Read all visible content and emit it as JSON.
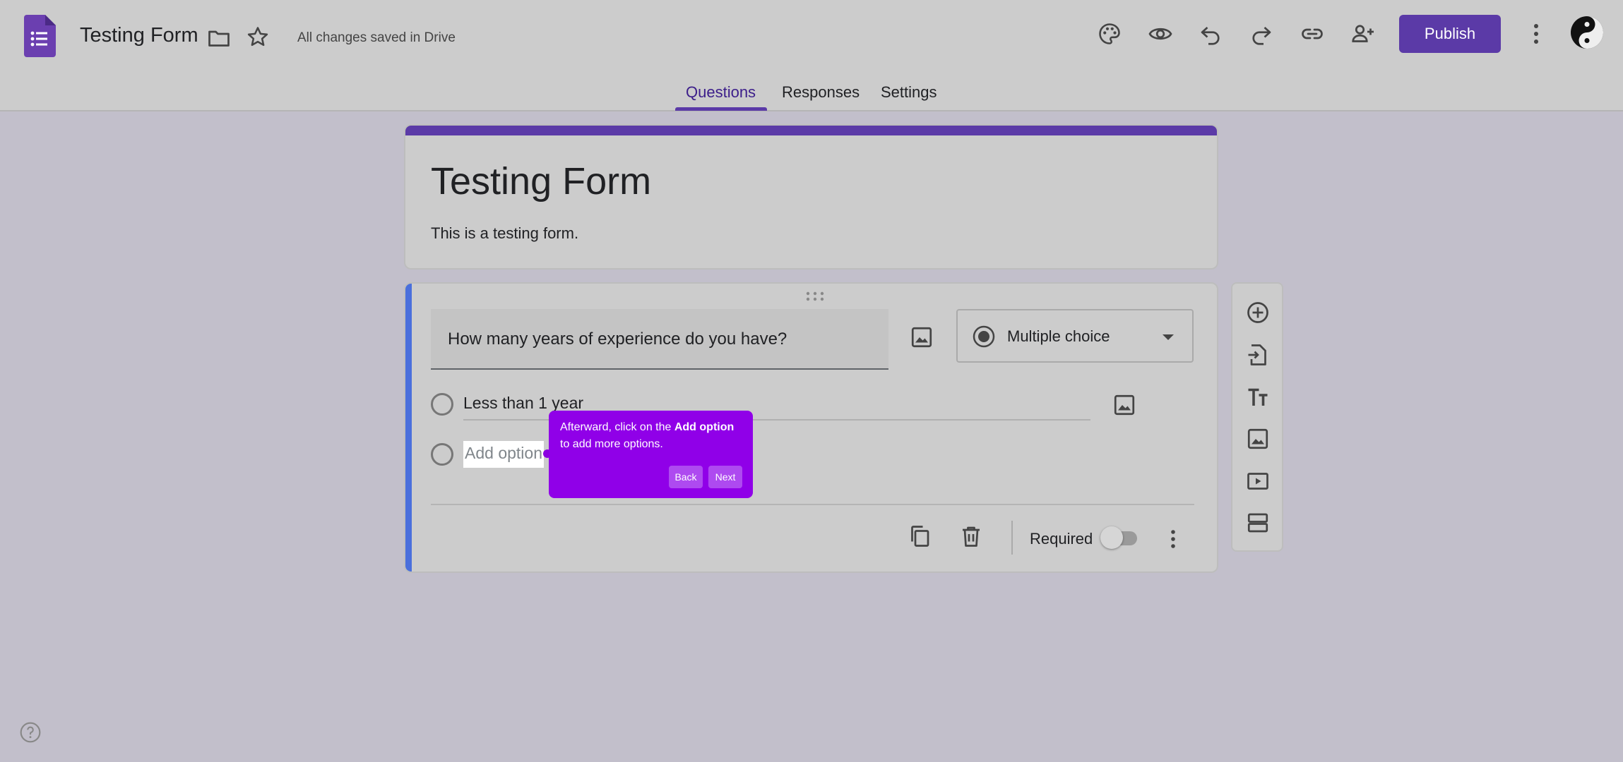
{
  "header": {
    "doc_title": "Testing Form",
    "save_status": "All changes saved in Drive",
    "publish_label": "Publish",
    "icons": [
      "palette-icon",
      "preview-eye-icon",
      "undo-icon",
      "redo-icon",
      "link-icon",
      "add-collaborator-icon",
      "more-vert-icon"
    ]
  },
  "tabs": [
    {
      "label": "Questions",
      "active": true
    },
    {
      "label": "Responses",
      "active": false
    },
    {
      "label": "Settings",
      "active": false
    }
  ],
  "form": {
    "title": "Testing Form",
    "description": "This is a testing form."
  },
  "question": {
    "text": "How many years of experience do you have?",
    "type": "Multiple choice",
    "options": [
      "Less than 1 year"
    ],
    "add_option_placeholder": "Add option",
    "required_label": "Required",
    "required": false
  },
  "tour": {
    "text_before": "Afterward, click on the ",
    "bold": "Add option",
    "text_after": " to add more options.",
    "back_label": "Back",
    "next_label": "Next"
  },
  "colors": {
    "accent": "#5b3aa7",
    "tour_bg": "#9000e8",
    "question_bar": "#4a6fdc"
  }
}
